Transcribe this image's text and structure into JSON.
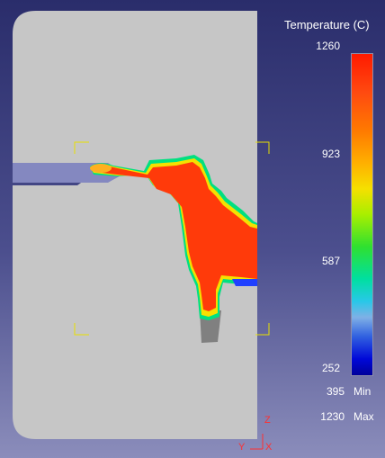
{
  "legend": {
    "title": "Temperature (C)",
    "ticks": [
      "1260",
      "923",
      "587",
      "252"
    ],
    "min_label": "Min",
    "min_value": "395",
    "max_label": "Max",
    "max_value": "1230"
  },
  "axes": {
    "z": "Z",
    "y": "Y",
    "x": "X"
  },
  "colors": {
    "background_top": "#2a2d6b",
    "background_bottom": "#8b8dbb",
    "mold": "#c6c6c6",
    "casting_hot": "#ff2a00",
    "casting_edge": "#00e080",
    "runner": "#8488c0",
    "marker": "#e8e000"
  }
}
